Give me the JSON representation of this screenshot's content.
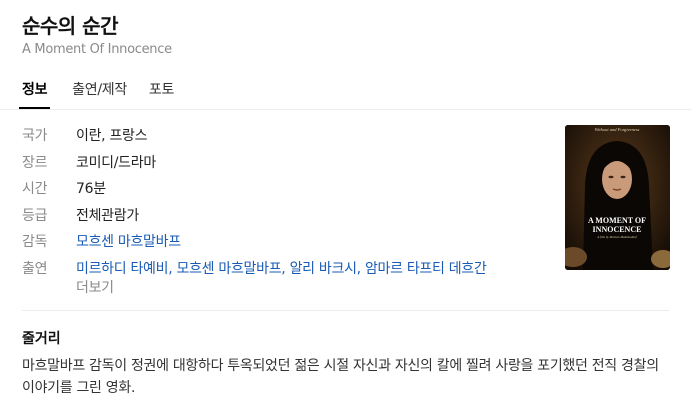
{
  "movie": {
    "title": "순수의 순간",
    "original_title": "A Moment Of Innocence"
  },
  "tabs": [
    {
      "label": "정보",
      "active": true
    },
    {
      "label": "출연/제작",
      "active": false
    },
    {
      "label": "포토",
      "active": false
    }
  ],
  "info": {
    "country": {
      "label": "국가",
      "value": "이란, 프랑스"
    },
    "genre": {
      "label": "장르",
      "value": "코미디/드라마"
    },
    "runtime": {
      "label": "시간",
      "value": "76분"
    },
    "rating": {
      "label": "등급",
      "value": "전체관람가"
    },
    "director": {
      "label": "감독",
      "value": "모흐센 마흐말바프"
    },
    "cast": {
      "label": "출연",
      "value": "미르하디 타예비, 모흐센 마흐말바프, 알리 바크시, 암마르 타프티 데흐간"
    },
    "more": "더보기"
  },
  "poster": {
    "top_text": "Without and Forgiveness",
    "title_line1": "A MOMENT OF",
    "title_line2": "INNOCENCE",
    "credit": "A film by Mohsen Makhmalbaf"
  },
  "summary": {
    "heading": "줄거리",
    "text": "마흐말바프 감독이 정권에 대항하다 투옥되었던 젊은 시절 자신과 자신의 칼에 찔려 사랑을 포기했던 전직 경찰의 이야기를 그린 영화."
  },
  "colors": {
    "link": "#1a5bb5",
    "label": "#8a8a8a",
    "divider": "#ececec"
  }
}
